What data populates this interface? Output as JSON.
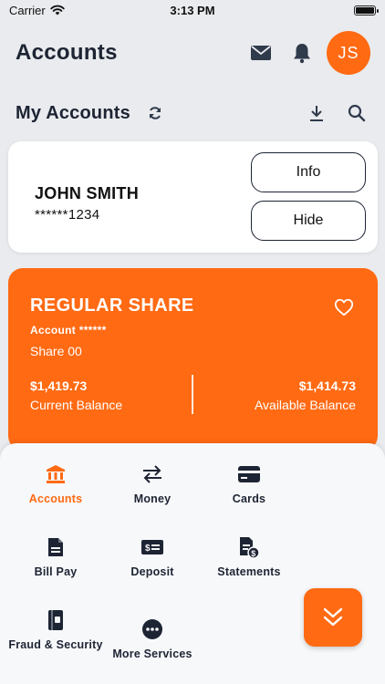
{
  "status_bar": {
    "carrier": "Carrier",
    "time": "3:13 PM"
  },
  "header": {
    "title": "Accounts",
    "avatar_initials": "JS"
  },
  "section": {
    "title": "My Accounts"
  },
  "member": {
    "name": "JOHN SMITH",
    "account_masked": "******1234",
    "info_label": "Info",
    "hide_label": "Hide"
  },
  "share": {
    "title": "REGULAR SHARE",
    "account_line": "Account ******",
    "subtitle": "Share 00",
    "current_balance": "$1,419.73",
    "current_label": "Current Balance",
    "available_balance": "$1,414.73",
    "available_label": "Available Balance"
  },
  "menu": {
    "items": [
      {
        "label": "Accounts",
        "icon": "bank-icon",
        "active": true
      },
      {
        "label": "Money",
        "icon": "transfer-icon",
        "active": false
      },
      {
        "label": "Cards",
        "icon": "card-icon",
        "active": false
      },
      {
        "label": "Bill Pay",
        "icon": "document-icon",
        "active": false
      },
      {
        "label": "Deposit",
        "icon": "check-deposit-icon",
        "active": false
      },
      {
        "label": "Statements",
        "icon": "statement-icon",
        "active": false
      },
      {
        "label": "Fraud & Security",
        "icon": "shield-book-icon",
        "active": false
      },
      {
        "label": "More Services",
        "icon": "more-dots-icon",
        "active": false
      }
    ]
  },
  "colors": {
    "accent": "#ff6a13",
    "text_dark": "#1d2433",
    "background": "#e9ebee"
  }
}
